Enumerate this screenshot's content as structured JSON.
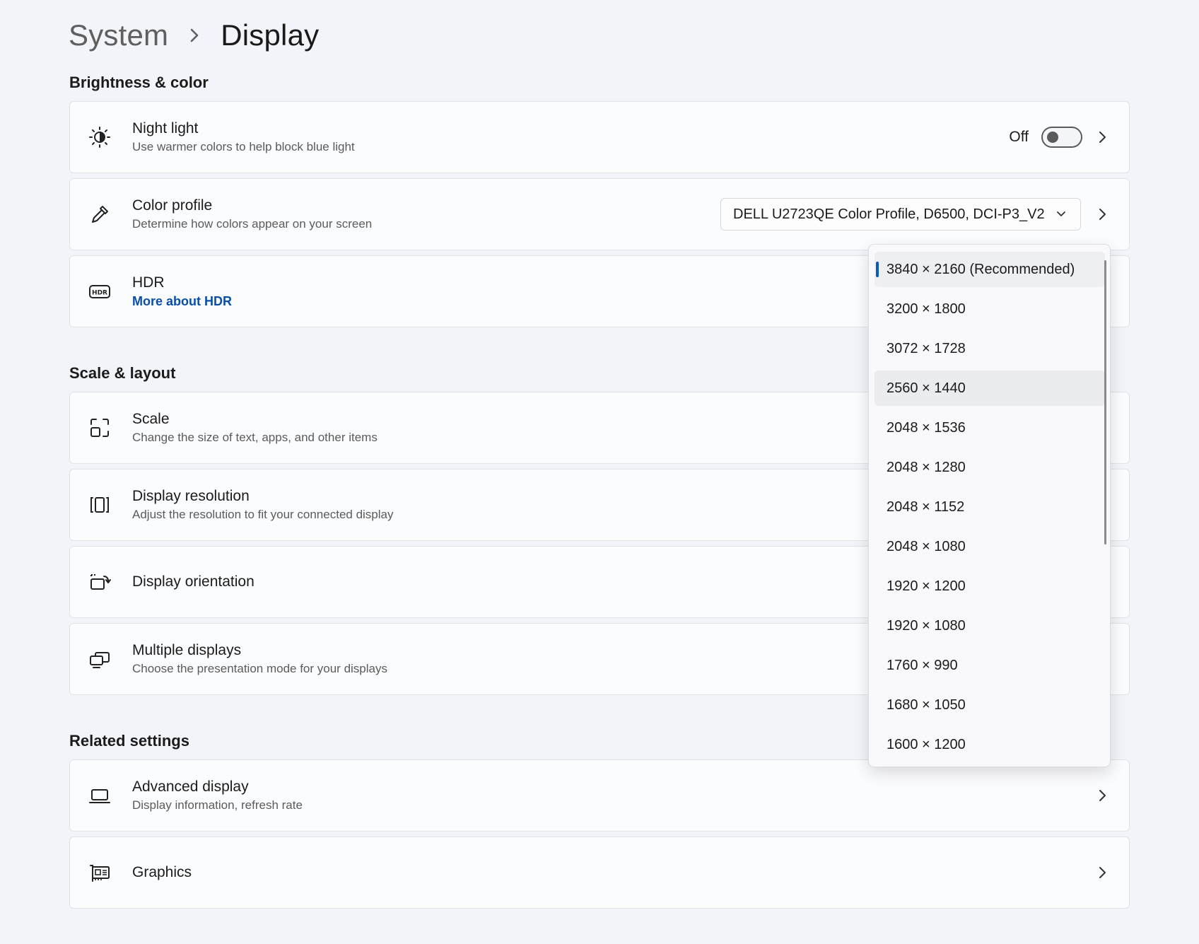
{
  "breadcrumb": {
    "parent": "System",
    "current": "Display"
  },
  "sections": {
    "brightness": "Brightness & color",
    "scale": "Scale & layout",
    "related": "Related settings"
  },
  "night_light": {
    "title": "Night light",
    "desc": "Use warmer colors to help block blue light",
    "state": "Off"
  },
  "color_profile": {
    "title": "Color profile",
    "desc": "Determine how colors appear on your screen",
    "value": "DELL U2723QE Color Profile, D6500, DCI-P3_V2"
  },
  "hdr": {
    "title": "HDR",
    "link": "More about HDR"
  },
  "scale": {
    "title": "Scale",
    "desc": "Change the size of text, apps, and other items"
  },
  "display_resolution": {
    "title": "Display resolution",
    "desc": "Adjust the resolution to fit your connected display"
  },
  "display_orientation": {
    "title": "Display orientation"
  },
  "multiple_displays": {
    "title": "Multiple displays",
    "desc": "Choose the presentation mode for your displays"
  },
  "advanced_display": {
    "title": "Advanced display",
    "desc": "Display information, refresh rate"
  },
  "graphics": {
    "title": "Graphics"
  },
  "resolution_options": [
    "3840 × 2160 (Recommended)",
    "3200 × 1800",
    "3072 × 1728",
    "2560 × 1440",
    "2048 × 1536",
    "2048 × 1280",
    "2048 × 1152",
    "2048 × 1080",
    "1920 × 1200",
    "1920 × 1080",
    "1760 × 990",
    "1680 × 1050",
    "1600 × 1200"
  ],
  "colors": {
    "accent": "#0b5cb8",
    "link": "#0a4ea8",
    "background": "#f2f4f9",
    "card": "#fbfcfe"
  }
}
